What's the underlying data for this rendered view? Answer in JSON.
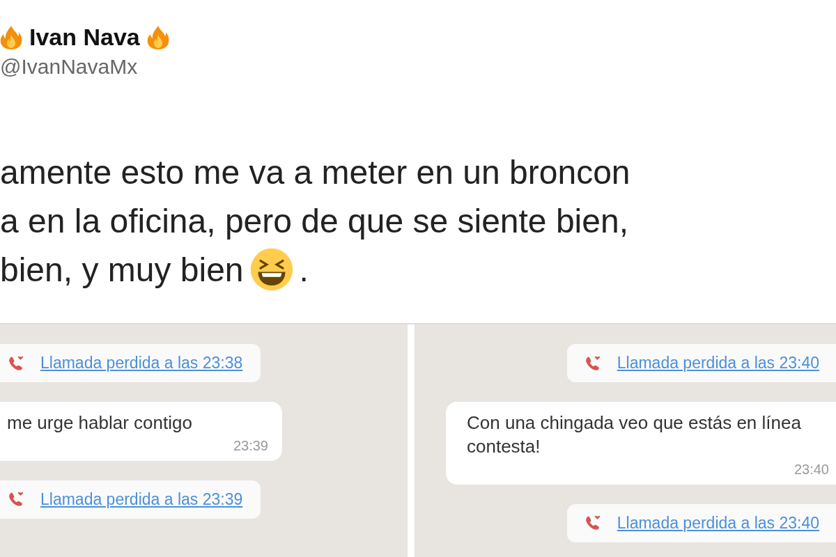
{
  "tweet": {
    "name": "Ivan Nava",
    "handle": "@IvanNavaMx",
    "text_lines": [
      {
        "text": "amente esto me va a meter en un broncon"
      },
      {
        "text": "a en la oficina, pero de que se siente bien,"
      },
      {
        "text": "bien, y muy bien",
        "emoji_after": true,
        "tail": "."
      }
    ]
  },
  "chats": [
    {
      "messages": [
        {
          "kind": "missed_call",
          "text": "Llamada perdida a las 23:38"
        },
        {
          "kind": "message",
          "text": "me urge hablar contigo",
          "time": "23:39"
        },
        {
          "kind": "missed_call",
          "text": "Llamada perdida a las 23:39"
        }
      ]
    },
    {
      "messages": [
        {
          "kind": "missed_call",
          "text": "Llamada perdida a las 23:40"
        },
        {
          "kind": "message",
          "text": "Con una chingada veo que estás en línea contesta!",
          "time": "23:40"
        },
        {
          "kind": "missed_call",
          "text": "Llamada perdida a las 23:40"
        }
      ]
    }
  ]
}
